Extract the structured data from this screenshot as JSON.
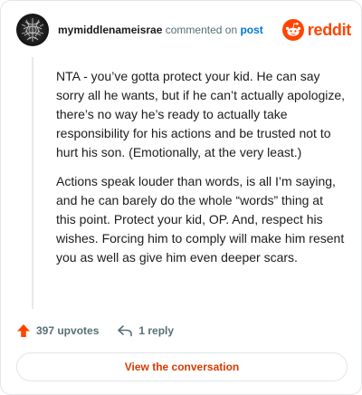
{
  "header": {
    "username": "mymiddlenameisrae",
    "commented_text": "commented on",
    "post_link": "post",
    "logo_text": "reddit"
  },
  "comment": {
    "paragraphs": [
      "NTA - you’ve gotta protect your kid. He can say sorry all he wants, but if he can’t actually apologize, there’s no way he’s ready to actually take responsibility for his actions and be trusted not to hurt his son. (Emotionally, at the very least.)",
      "Actions speak louder than words, is all I’m saying, and he can barely do the whole “words” thing at this point. Protect your kid, OP. And, respect his wishes. Forcing him to comply will make him resent you as well as give him even deeper scars."
    ]
  },
  "actions": {
    "upvotes": "397 upvotes",
    "replies": "1 reply"
  },
  "cta": {
    "label": "View the conversation"
  },
  "colors": {
    "brand": "#ff4500",
    "link": "#0079d3",
    "cta_text": "#d93a00",
    "muted": "#576f76"
  },
  "icons": {
    "upvote": "upvote-arrow-icon",
    "reply": "reply-arrow-icon",
    "logo": "reddit-snoo-icon"
  }
}
